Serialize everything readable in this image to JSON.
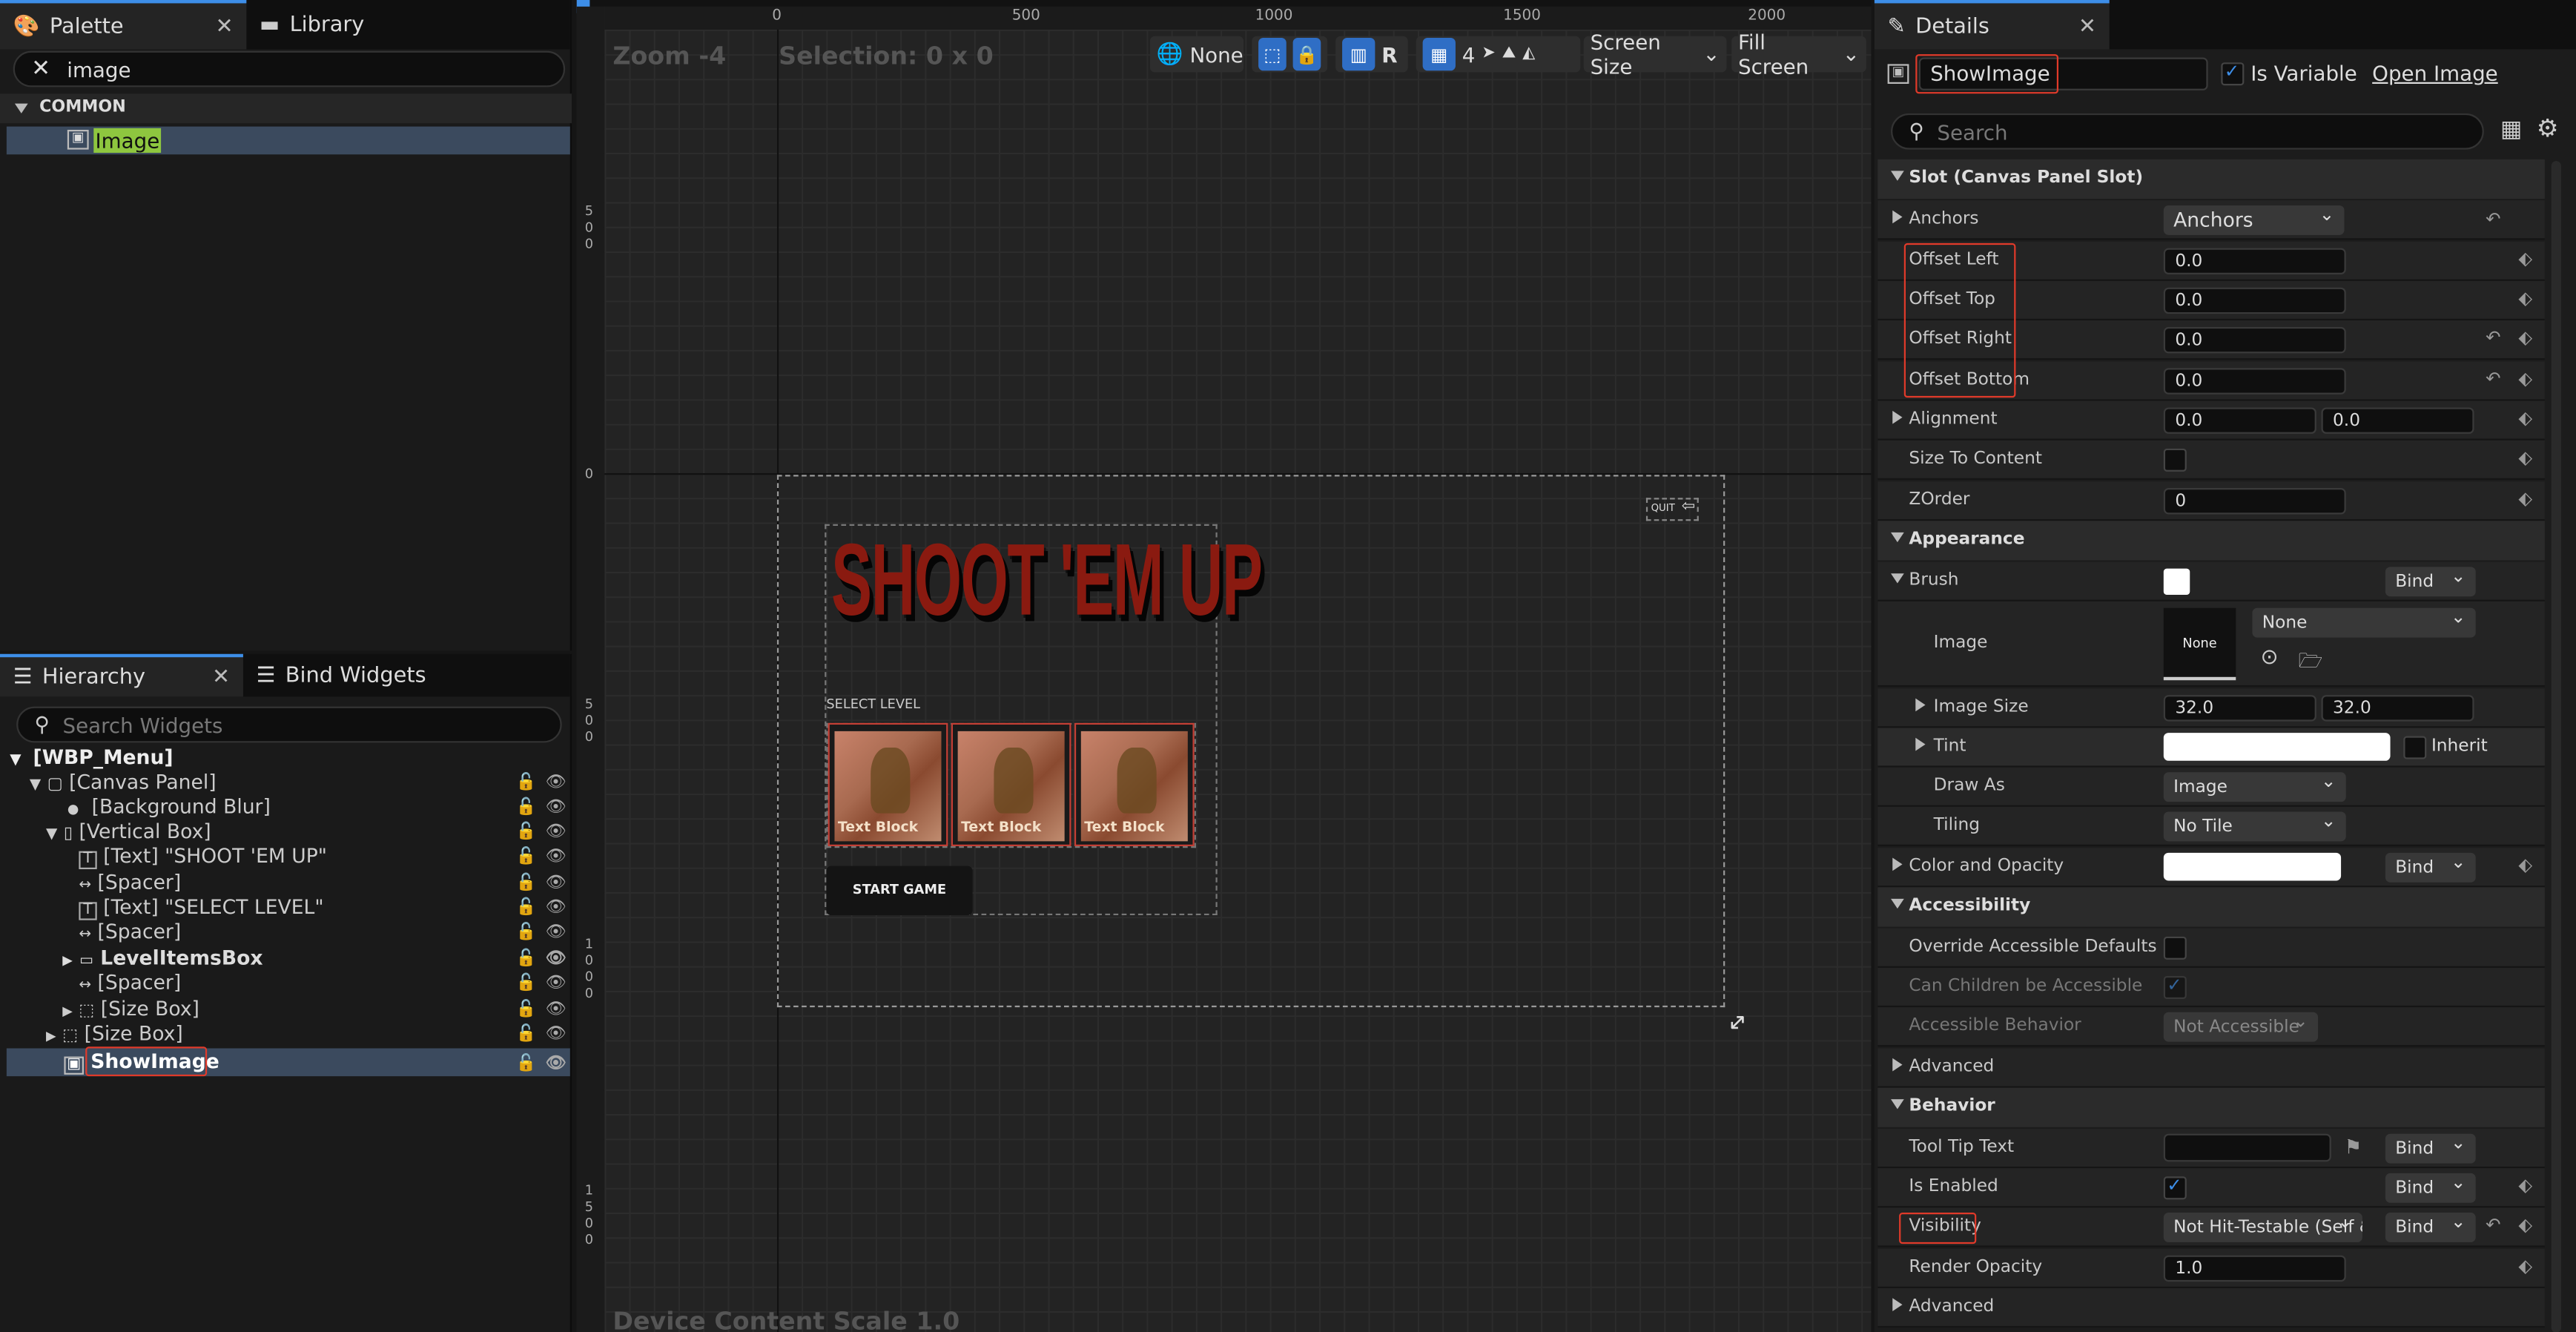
{
  "palette": {
    "tab_label": "Palette",
    "library_label": "Library",
    "search_value": "image",
    "category": "COMMON",
    "item": "Image"
  },
  "hierarchy": {
    "tab_label": "Hierarchy",
    "bind_widgets_label": "Bind Widgets",
    "search_placeholder": "Search Widgets",
    "items": [
      {
        "label": "[WBP_Menu]"
      },
      {
        "label": "[Canvas Panel]"
      },
      {
        "label": "[Background Blur]"
      },
      {
        "label": "[Vertical Box]"
      },
      {
        "label": "[Text] \"SHOOT 'EM UP\""
      },
      {
        "label": "[Spacer]"
      },
      {
        "label": "[Text] \"SELECT LEVEL\""
      },
      {
        "label": "[Spacer]"
      },
      {
        "label": "LevelItemsBox"
      },
      {
        "label": "[Spacer]"
      },
      {
        "label": "[Size Box]"
      },
      {
        "label": "[Size Box]"
      },
      {
        "label": "ShowImage"
      }
    ]
  },
  "viewport": {
    "zoom": "Zoom -4",
    "selection": "Selection: 0 x 0",
    "ruler_labels": [
      "0",
      "500",
      "1000",
      "1500",
      "2000"
    ],
    "ruler_v_labels": [
      "500",
      "0",
      "500",
      "1000",
      "1500"
    ],
    "toolbar": {
      "none_label": "None",
      "r_label": "R",
      "grid_value": "4",
      "screen_size_label": "Screen Size",
      "fill_screen_label": "Fill Screen"
    },
    "device_scale": "Device Content Scale 1.0",
    "game": {
      "title": "SHOOT 'EM UP",
      "select_level": "SELECT LEVEL",
      "level_labels": [
        "Text Block",
        "Text Block",
        "Text Block"
      ],
      "start_button": "START GAME",
      "quit_label": "QUIT"
    }
  },
  "details": {
    "tab_label": "Details",
    "widget_name": "ShowImage",
    "is_variable_label": "Is Variable",
    "open_image_label": "Open Image",
    "search_placeholder": "Search",
    "sections": {
      "slot": "Slot (Canvas Panel Slot)",
      "appearance": "Appearance",
      "accessibility": "Accessibility",
      "advanced": "Advanced",
      "behavior": "Behavior",
      "advanced2": "Advanced"
    },
    "props": {
      "anchors_label": "Anchors",
      "anchors_value": "Anchors",
      "offset_left": "Offset Left",
      "offset_left_value": "0.0",
      "offset_top": "Offset Top",
      "offset_top_value": "0.0",
      "offset_right": "Offset Right",
      "offset_right_value": "0.0",
      "offset_bottom": "Offset Bottom",
      "offset_bottom_value": "0.0",
      "alignment": "Alignment",
      "alignment_x": "0.0",
      "alignment_y": "0.0",
      "size_to_content": "Size To Content",
      "zorder": "ZOrder",
      "zorder_value": "0",
      "brush": "Brush",
      "bind": "Bind",
      "image": "Image",
      "image_none": "None",
      "image_dropdown": "None",
      "image_size": "Image Size",
      "image_size_x": "32.0",
      "image_size_y": "32.0",
      "tint": "Tint",
      "inherit": "Inherit",
      "draw_as": "Draw As",
      "draw_as_value": "Image",
      "tiling": "Tiling",
      "tiling_value": "No Tile",
      "color_opacity": "Color and Opacity",
      "override_accessible": "Override Accessible Defaults",
      "can_children": "Can Children be Accessible",
      "accessible_behavior": "Accessible Behavior",
      "accessible_behavior_value": "Not Accessible",
      "tooltip": "Tool Tip Text",
      "is_enabled": "Is Enabled",
      "visibility": "Visibility",
      "visibility_value": "Not Hit-Testable (Self &",
      "render_opacity": "Render Opacity",
      "render_opacity_value": "1.0"
    }
  },
  "colors": {
    "accent": "#3d8ee8",
    "highlight_red": "#e03a2a",
    "title_red": "#8a1a10",
    "selection_row": "#3b4a5e"
  }
}
